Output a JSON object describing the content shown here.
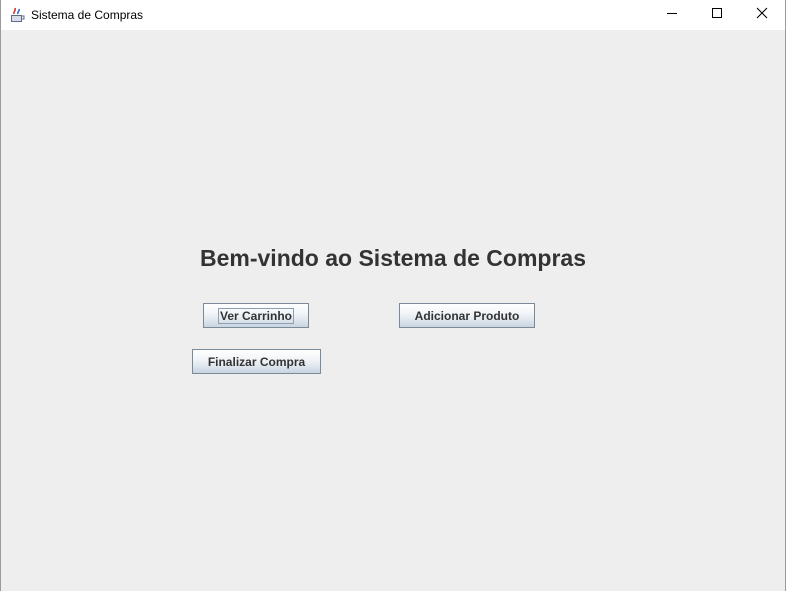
{
  "window": {
    "title": "Sistema de Compras",
    "app_icon": "java-cup-icon",
    "controls": {
      "minimize_icon": "minimize-icon",
      "maximize_icon": "maximize-icon",
      "close_icon": "close-icon"
    }
  },
  "main": {
    "heading": "Bem-vindo ao Sistema de Compras",
    "buttons": {
      "ver_carrinho": "Ver Carrinho",
      "adicionar_produto": "Adicionar Produto",
      "finalizar_compra": "Finalizar Compra"
    }
  },
  "colors": {
    "background": "#eeeeee",
    "heading_text": "#333333",
    "button_border": "#7a8a99"
  }
}
